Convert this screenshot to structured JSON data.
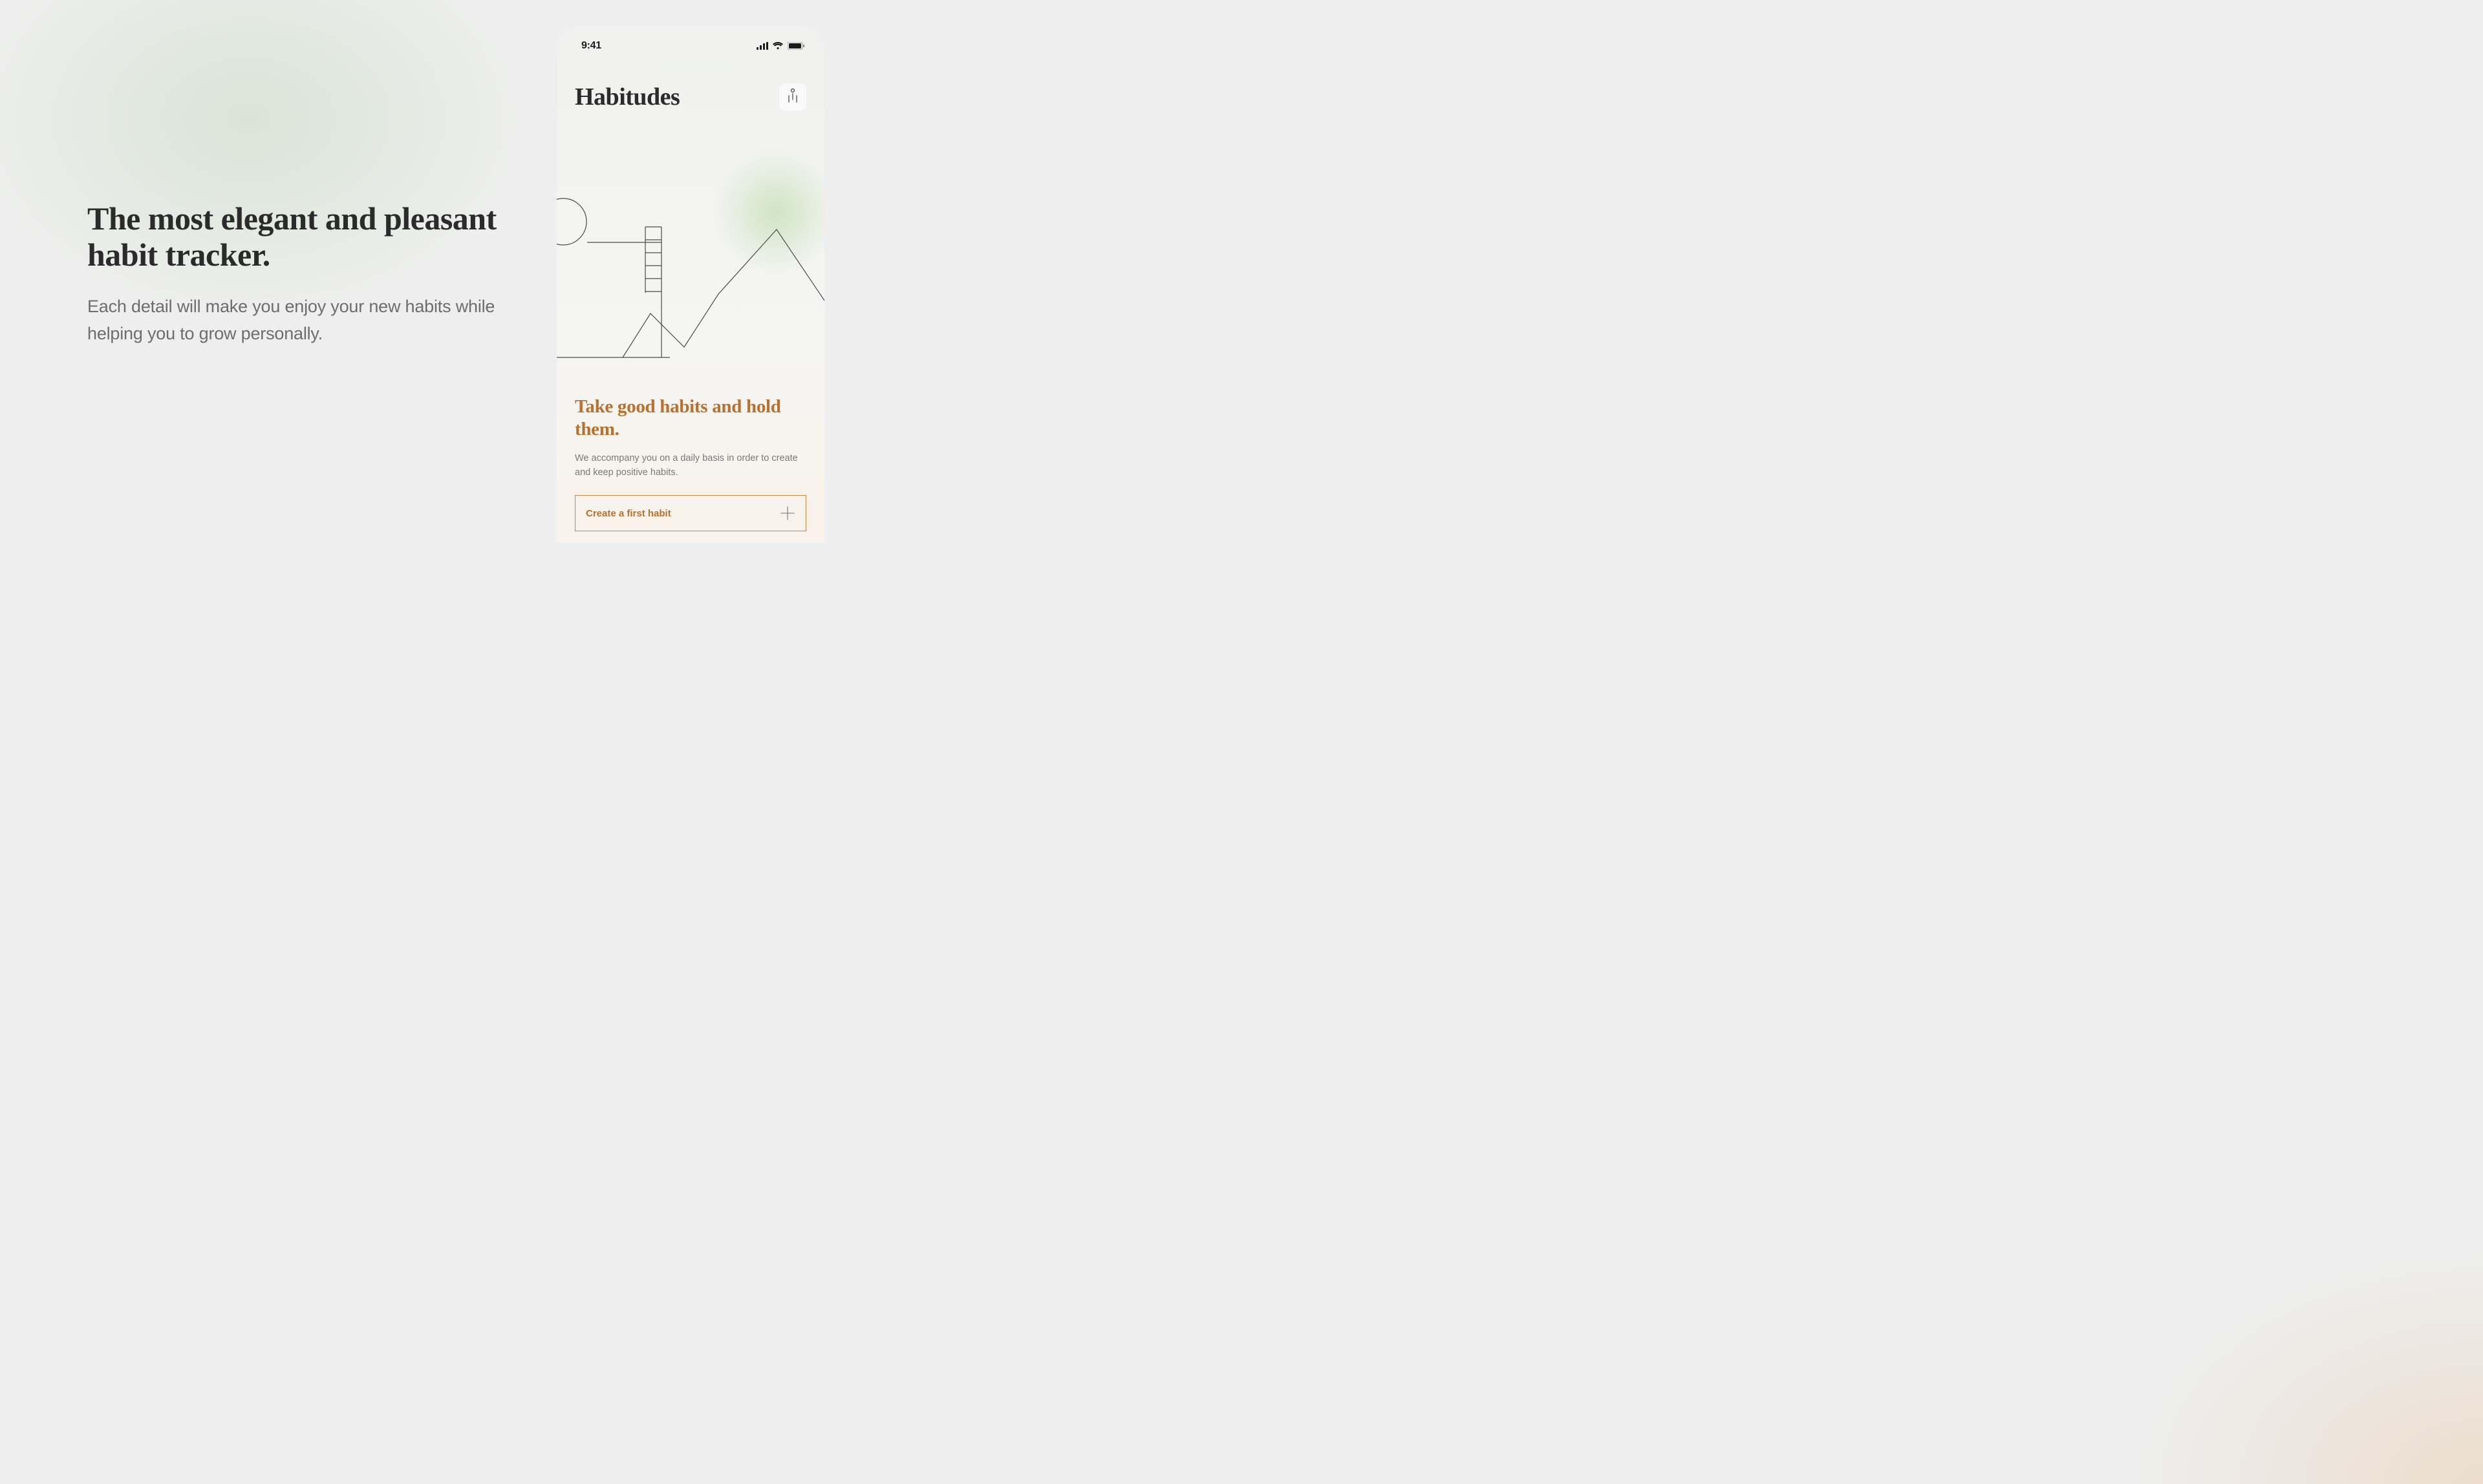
{
  "colors": {
    "text_dark": "#2b2b2b",
    "text_muted": "#6d6d6d",
    "accent_orange": "#b9712e",
    "accent_orange_border": "#c98a4a",
    "phone_bg": "#f0f1ef",
    "green_glow": "rgba(140,200,110,0.35)"
  },
  "marketing": {
    "headline": "The most elegant and pleasant habit tracker.",
    "subcopy": "Each detail will make you enjoy your new habits while helping you to grow personally."
  },
  "phone": {
    "status": {
      "time": "9:41",
      "signal_icon": "cellular-signal-icon",
      "wifi_icon": "wifi-icon",
      "battery_icon": "battery-full-icon"
    },
    "header": {
      "app_name": "Habitudes",
      "settings_icon": "settings-sliders-icon"
    },
    "onboarding": {
      "title": "Take good habits and hold them.",
      "body": "We accompany you on a daily basis in order to create and keep positive habits.",
      "cta_label": "Create a first habit",
      "cta_icon": "plus-icon"
    }
  }
}
